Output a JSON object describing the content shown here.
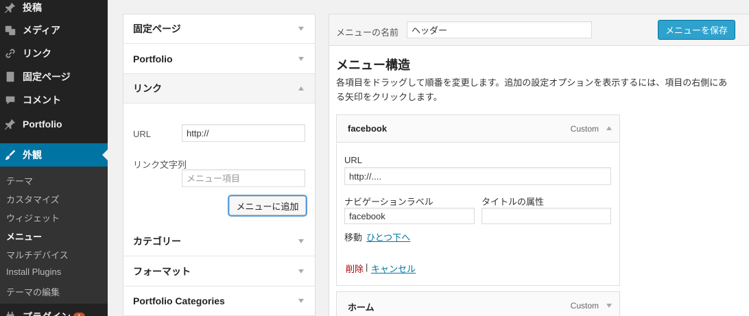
{
  "sidebar": {
    "items": [
      {
        "label": "投稿",
        "icon": "pin-icon"
      },
      {
        "label": "メディア",
        "icon": "media-icon"
      },
      {
        "label": "リンク",
        "icon": "link-icon"
      },
      {
        "label": "固定ページ",
        "icon": "page-icon"
      },
      {
        "label": "コメント",
        "icon": "comment-icon"
      },
      {
        "label": "Portfolio",
        "icon": "pin-icon"
      },
      {
        "label": "外観",
        "icon": "brush-icon"
      }
    ],
    "submenu": [
      "テーマ",
      "カスタマイズ",
      "ウィジェット",
      "メニュー",
      "マルチデバイス",
      "Install Plugins",
      "テーマの編集"
    ],
    "plugins": {
      "label": "プラグイン",
      "badge": "1"
    }
  },
  "accordion": {
    "sections": [
      "固定ページ",
      "Portfolio",
      "リンク",
      "カテゴリー",
      "フォーマット",
      "Portfolio Categories"
    ],
    "links": {
      "url_label": "URL",
      "url_value": "http://",
      "text_label": "リンク文字列",
      "text_placeholder": "メニュー項目",
      "add_button": "メニューに追加"
    }
  },
  "menu": {
    "name_label": "メニューの名前",
    "name_value": "ヘッダー",
    "save_button": "メニューを保存",
    "structure_title": "メニュー構造",
    "structure_desc_1": "各項目をドラッグして順番を変更します。追加の設定オプションを表示するには、項目の右側にあ",
    "structure_desc_2": "る矢印をクリックします。",
    "items": [
      {
        "title": "facebook",
        "type": "Custom",
        "url_label": "URL",
        "url_value": "http://....",
        "nav_label_label": "ナビゲーションラベル",
        "nav_label_value": "facebook",
        "title_attr_label": "タイトルの属性",
        "title_attr_value": "",
        "move_label": "移動",
        "move_link": "ひとつ下へ",
        "delete_link": "削除",
        "separator": "|",
        "cancel_link": "キャンセル"
      },
      {
        "title": "ホーム",
        "type": "Custom"
      }
    ]
  }
}
